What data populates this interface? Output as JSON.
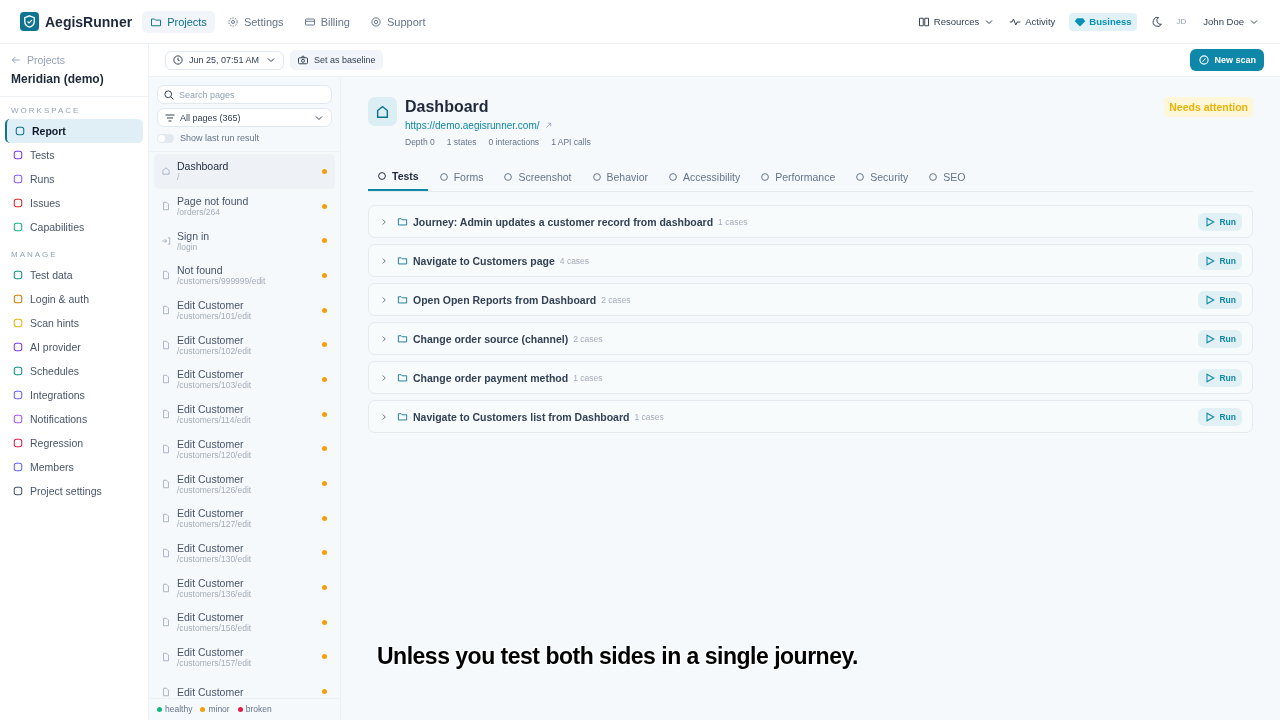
{
  "brand": "AegisRunner",
  "top_nav": [
    {
      "label": "Projects",
      "selected": true
    },
    {
      "label": "Settings",
      "selected": false
    },
    {
      "label": "Billing",
      "selected": false
    },
    {
      "label": "Support",
      "selected": false
    }
  ],
  "top_right": {
    "resources": "Resources",
    "activity": "Activity",
    "plan": "Business",
    "user_initials": "JD",
    "user_name": "John Doe"
  },
  "sidebar": {
    "back": "Projects",
    "project": "Meridian (demo)",
    "sections": [
      {
        "title": "WORKSPACE",
        "items": [
          {
            "label": "Report",
            "selected": true
          },
          {
            "label": "Tests",
            "selected": false
          },
          {
            "label": "Runs",
            "selected": false
          },
          {
            "label": "Issues",
            "selected": false
          },
          {
            "label": "Capabilities",
            "selected": false
          }
        ]
      },
      {
        "title": "MANAGE",
        "items": [
          {
            "label": "Test data",
            "selected": false
          },
          {
            "label": "Login & auth",
            "selected": false
          },
          {
            "label": "Scan hints",
            "selected": false
          },
          {
            "label": "AI provider",
            "selected": false
          },
          {
            "label": "Schedules",
            "selected": false
          },
          {
            "label": "Integrations",
            "selected": false
          },
          {
            "label": "Notifications",
            "selected": false
          },
          {
            "label": "Regression",
            "selected": false
          },
          {
            "label": "Members",
            "selected": false
          },
          {
            "label": "Project settings",
            "selected": false
          }
        ]
      }
    ]
  },
  "toolbar": {
    "run_select": "Jun 25, 07:51 AM",
    "baseline_button": "Set as baseline",
    "new_scan_button": "New scan"
  },
  "pages": {
    "search_placeholder": "Search pages",
    "filter": "All pages (365)",
    "toggle": {
      "label": "Show last run result",
      "on": false
    },
    "items": [
      {
        "title": "Dashboard",
        "path": "/",
        "kind": "home",
        "color": "#f59e0b",
        "selected": true
      },
      {
        "title": "Page not found",
        "path": "/orders/264",
        "kind": "page",
        "color": "#f59e0b",
        "selected": false
      },
      {
        "title": "Sign in",
        "path": "/login",
        "kind": "login",
        "color": "#f59e0b",
        "selected": false
      },
      {
        "title": "Not found",
        "path": "/customers/999999/edit",
        "kind": "page",
        "color": "#f59e0b",
        "selected": false
      },
      {
        "title": "Edit Customer",
        "path": "/customers/101/edit",
        "kind": "page",
        "color": "#f59e0b",
        "selected": false
      },
      {
        "title": "Edit Customer",
        "path": "/customers/102/edit",
        "kind": "page",
        "color": "#f59e0b",
        "selected": false
      },
      {
        "title": "Edit Customer",
        "path": "/customers/103/edit",
        "kind": "page",
        "color": "#f59e0b",
        "selected": false
      },
      {
        "title": "Edit Customer",
        "path": "/customers/114/edit",
        "kind": "page",
        "color": "#f59e0b",
        "selected": false
      },
      {
        "title": "Edit Customer",
        "path": "/customers/120/edit",
        "kind": "page",
        "color": "#f59e0b",
        "selected": false
      },
      {
        "title": "Edit Customer",
        "path": "/customers/126/edit",
        "kind": "page",
        "color": "#f59e0b",
        "selected": false
      },
      {
        "title": "Edit Customer",
        "path": "/customers/127/edit",
        "kind": "page",
        "color": "#f59e0b",
        "selected": false
      },
      {
        "title": "Edit Customer",
        "path": "/customers/130/edit",
        "kind": "page",
        "color": "#f59e0b",
        "selected": false
      },
      {
        "title": "Edit Customer",
        "path": "/customers/136/edit",
        "kind": "page",
        "color": "#f59e0b",
        "selected": false
      },
      {
        "title": "Edit Customer",
        "path": "/customers/156/edit",
        "kind": "page",
        "color": "#f59e0b",
        "selected": false
      },
      {
        "title": "Edit Customer",
        "path": "/customers/157/edit",
        "kind": "page",
        "color": "#f59e0b",
        "selected": false
      },
      {
        "title": "Edit Customer",
        "kind": "page",
        "color": "#f59e0b",
        "selected": false
      }
    ],
    "legend": [
      {
        "label": "healthy",
        "color": "#10b981"
      },
      {
        "label": "minor",
        "color": "#f59e0b"
      },
      {
        "label": "broken",
        "color": "#e11d48"
      }
    ]
  },
  "detail": {
    "title": "Dashboard",
    "url": "https://demo.aegisrunner.com/",
    "status_badge": "Needs attention",
    "stats": [
      "Depth 0",
      "1 states",
      "0 interactions",
      "1 API calls"
    ],
    "tabs": [
      {
        "label": "Tests",
        "selected": true
      },
      {
        "label": "Forms",
        "selected": false
      },
      {
        "label": "Screenshot",
        "selected": false
      },
      {
        "label": "Behavior",
        "selected": false
      },
      {
        "label": "Accessibility",
        "selected": false
      },
      {
        "label": "Performance",
        "selected": false
      },
      {
        "label": "Security",
        "selected": false
      },
      {
        "label": "SEO",
        "selected": false
      }
    ],
    "suites": [
      {
        "name": "Journey: Admin updates a customer record from dashboard",
        "count": "1 cases",
        "run": "Run"
      },
      {
        "name": "Navigate to Customers page",
        "count": "4 cases",
        "run": "Run"
      },
      {
        "name": "Open Open Reports from Dashboard",
        "count": "2 cases",
        "run": "Run"
      },
      {
        "name": "Change order source (channel)",
        "count": "2 cases",
        "run": "Run"
      },
      {
        "name": "Change order payment method",
        "count": "1 cases",
        "run": "Run"
      },
      {
        "name": "Navigate to Customers list from Dashboard",
        "count": "1 cases",
        "run": "Run"
      }
    ]
  },
  "caption": "Unless you test both sides in a single journey."
}
